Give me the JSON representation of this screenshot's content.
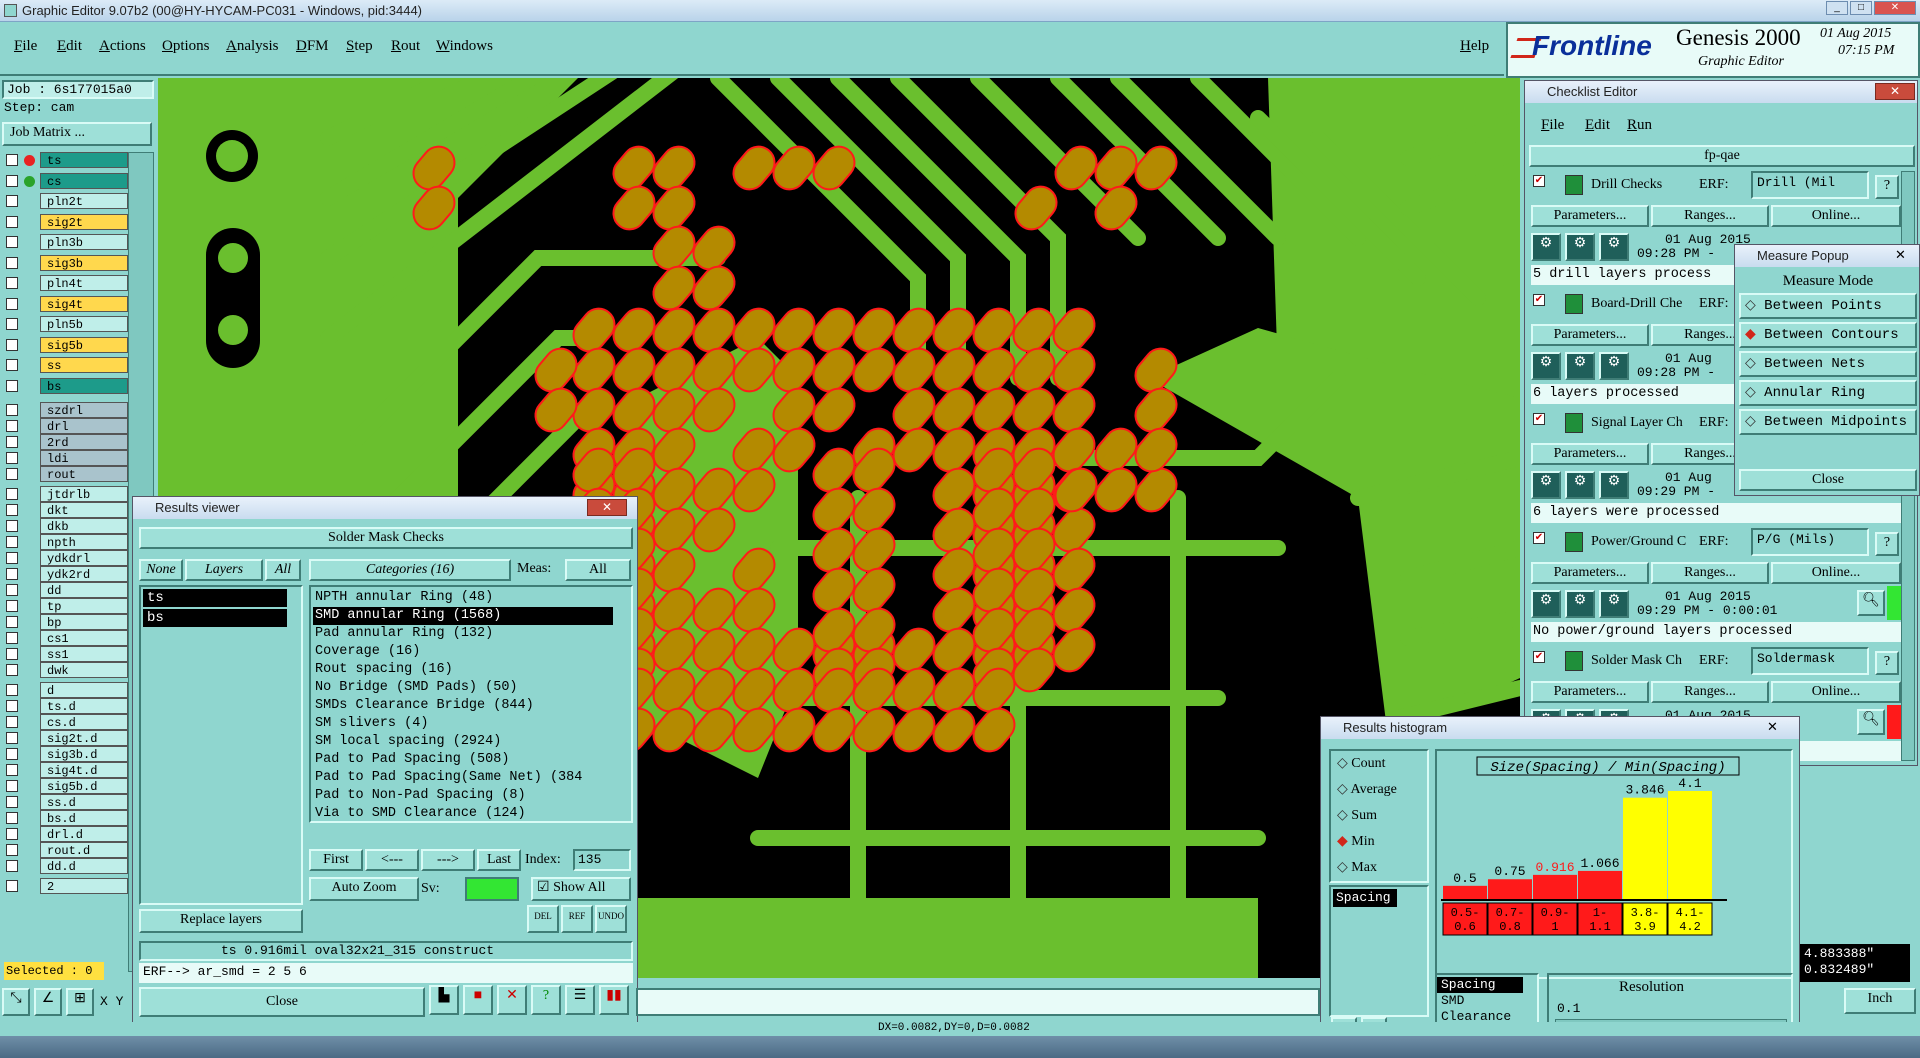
{
  "window": {
    "title": "Graphic Editor 9.07b2 (00@HY-HYCAM-PC031 - Windows, pid:3444)"
  },
  "menu": [
    "File",
    "Edit",
    "Actions",
    "Options",
    "Analysis",
    "DFM",
    "Step",
    "Rout",
    "Windows"
  ],
  "help": "Help",
  "brand": {
    "logo": "Frontline",
    "product": "Genesis 2000",
    "subtitle": "Graphic Editor",
    "date": "01 Aug 2015",
    "time": "07:15 PM"
  },
  "job": {
    "job": "Job : 6s177015a0",
    "step": "Step: cam",
    "matrix_button": "Job Matrix ..."
  },
  "layers": [
    "ts",
    "cs",
    "pln2t",
    "sig2t",
    "pln3b",
    "sig3b",
    "pln4t",
    "sig4t",
    "pln5b",
    "sig5b",
    "ss",
    "bs",
    "szdrl",
    "drl",
    "2rd",
    "ldi",
    "rout",
    "jtdrlb",
    "dkt",
    "dkb",
    "npth",
    "ydkdrl",
    "ydk2rd",
    "dd",
    "tp",
    "bp",
    "cs1",
    "ss1",
    "dwk",
    "d",
    "ts.d",
    "cs.d",
    "sig2t.d",
    "sig3b.d",
    "sig4t.d",
    "sig5b.d",
    "ss.d",
    "bs.d",
    "drl.d",
    "rout.d",
    "dd.d",
    "2"
  ],
  "selected": "Selected : 0",
  "xy": "X Y",
  "status_readout": "DX=0.0082,DY=0,D=0.0082",
  "unit": "Inch",
  "coords": {
    "x": "4.883388\"",
    "y": "0.832489\""
  },
  "results_viewer": {
    "title": "Results viewer",
    "header": "Solder Mask Checks",
    "none": "None",
    "layers_label": "Layers",
    "all": "All",
    "categories": "Categories (16)",
    "meas_label": "Meas:",
    "meas_value": "All",
    "selected_layers": [
      "ts",
      "bs"
    ],
    "items": [
      "NPTH annular Ring (48)",
      "SMD annular Ring (1568)",
      "Pad annular Ring (132)",
      "Coverage (16)",
      "Rout spacing (16)",
      "No Bridge (SMD Pads) (50)",
      "SMDs Clearance Bridge (844)",
      "SM slivers (4)",
      "SM local spacing (2924)",
      "Pad to Pad Spacing (508)",
      "Pad to Pad Spacing(Same Net) (384",
      "Pad to Non-Pad Spacing (8)",
      "Via to SMD Clearance (124)"
    ],
    "first": "First",
    "prev": "<---",
    "next": "--->",
    "last": "Last",
    "index_label": "Index:",
    "index_value": "135",
    "auto_zoom": "Auto Zoom",
    "sv": "Sv:",
    "show_all": "Show All",
    "replace_layers": "Replace layers",
    "info": "ts 0.916mil    oval32x21_315   construct",
    "erf": "ERF--> ar_smd = 2 5 6",
    "close": "Close"
  },
  "checklist": {
    "title": "Checklist Editor",
    "menu": [
      "File",
      "Edit",
      "Run"
    ],
    "name": "fp-qae",
    "checks": [
      {
        "name": "Drill Checks",
        "erf": "Drill (Mil",
        "date": "01 Aug 2015",
        "time": "09:28 PM -",
        "msg": "5 drill layers process"
      },
      {
        "name": "Board-Drill Che",
        "erf": "",
        "date": "01 Aug",
        "time": "09:28 PM -",
        "msg": "6 layers processed"
      },
      {
        "name": "Signal Layer Ch",
        "erf": "",
        "date": "01 Aug",
        "time": "09:29 PM -",
        "msg": "6 layers were processed"
      },
      {
        "name": "Power/Ground C",
        "erf": "P/G (Mils)",
        "date": "01 Aug 2015",
        "time": "09:29 PM - 0:00:01",
        "msg": "No power/ground layers processed"
      },
      {
        "name": "Solder Mask Ch",
        "erf": "Soldermask",
        "date": "01 Aug 2015",
        "time": "",
        "msg": "ocessed"
      }
    ],
    "erf_label": "ERF:",
    "parameters": "Parameters...",
    "ranges": "Ranges...",
    "online": "Online..."
  },
  "measure": {
    "title": "Measure Popup",
    "header": "Measure Mode",
    "modes": [
      "Between Points",
      "Between Contours",
      "Between Nets",
      "Annular Ring",
      "Between Midpoints"
    ],
    "selected": "Between Contours",
    "close": "Close"
  },
  "histogram": {
    "title": "Results histogram",
    "options": [
      "Count",
      "Average",
      "Sum",
      "Min",
      "Max"
    ],
    "selected_option": "Min",
    "list_top": "Spacing",
    "list": [
      "Spacing",
      "SMD",
      "Clearance"
    ],
    "resolution_label": "Resolution",
    "resolution_value": "0.1",
    "chart_title": "Size(Spacing) / Min(Spacing)"
  },
  "chart_data": {
    "type": "bar",
    "title": "Size(Spacing) / Min(Spacing)",
    "categories": [
      "0.5-0.6",
      "0.7-0.8",
      "0.9-1",
      "1-1.1",
      "3.8-3.9",
      "4.1-4.2"
    ],
    "values": [
      0.5,
      0.75,
      0.916,
      1.066,
      3.846,
      4.1
    ],
    "labels": [
      "0.5",
      "0.75",
      "0.916",
      "1.066",
      "3.846",
      "4.1"
    ],
    "cat_top": [
      "0.5-",
      "0.7-",
      "0.9-",
      "1-",
      "3.8-",
      "4.1-"
    ],
    "cat_bot": [
      "0.6",
      "0.8",
      "1",
      "1.1",
      "3.9",
      "4.2"
    ],
    "colors": [
      "#ff1a1a",
      "#ff1a1a",
      "#ff1a1a",
      "#ff1a1a",
      "#ffff00",
      "#ffff00"
    ],
    "ylim": [
      0,
      4.1
    ]
  },
  "colors": {
    "board": "#6abf2e",
    "pad": "#b48a00",
    "outline": "#ff1a1a",
    "bg": "#8fd6cf"
  }
}
